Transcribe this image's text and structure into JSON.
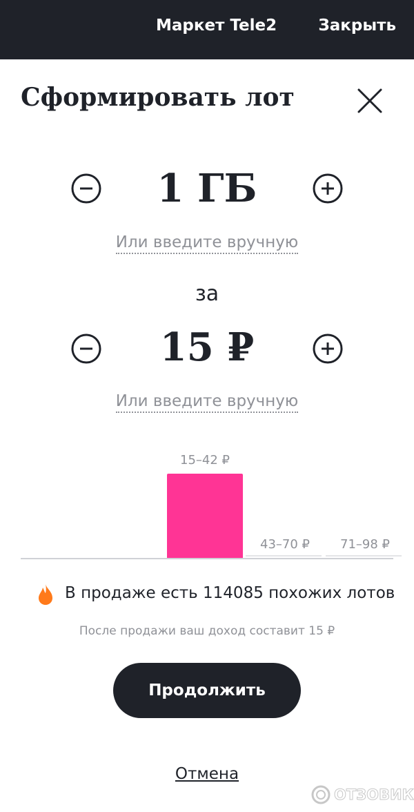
{
  "header": {
    "title": "Маркет Tele2",
    "close_label": "Закрыть"
  },
  "form": {
    "heading": "Сформировать лот",
    "data_amount": "1 ГБ",
    "manual_entry_label": "Или введите вручную",
    "for_label": "за",
    "price": "15 ₽",
    "manual_entry_label_price": "Или введите вручную"
  },
  "chart_data": {
    "type": "bar",
    "categories": [
      "15–42 ₽",
      "43–70 ₽",
      "71–98 ₽"
    ],
    "values": [
      1,
      0,
      0
    ],
    "highlight_color": "#ff3495"
  },
  "info": {
    "similar_lots": "В продаже есть 114085 похожих лотов",
    "income_note": "После продажи ваш доход составит 15 ₽"
  },
  "actions": {
    "continue_label": "Продолжить",
    "cancel_label": "Отмена"
  },
  "watermark": {
    "text": "ОТЗОВИК"
  },
  "colors": {
    "dark": "#1f2229",
    "accent": "#ff3495",
    "flame": "#ff7a1a",
    "muted": "#8f9197"
  }
}
